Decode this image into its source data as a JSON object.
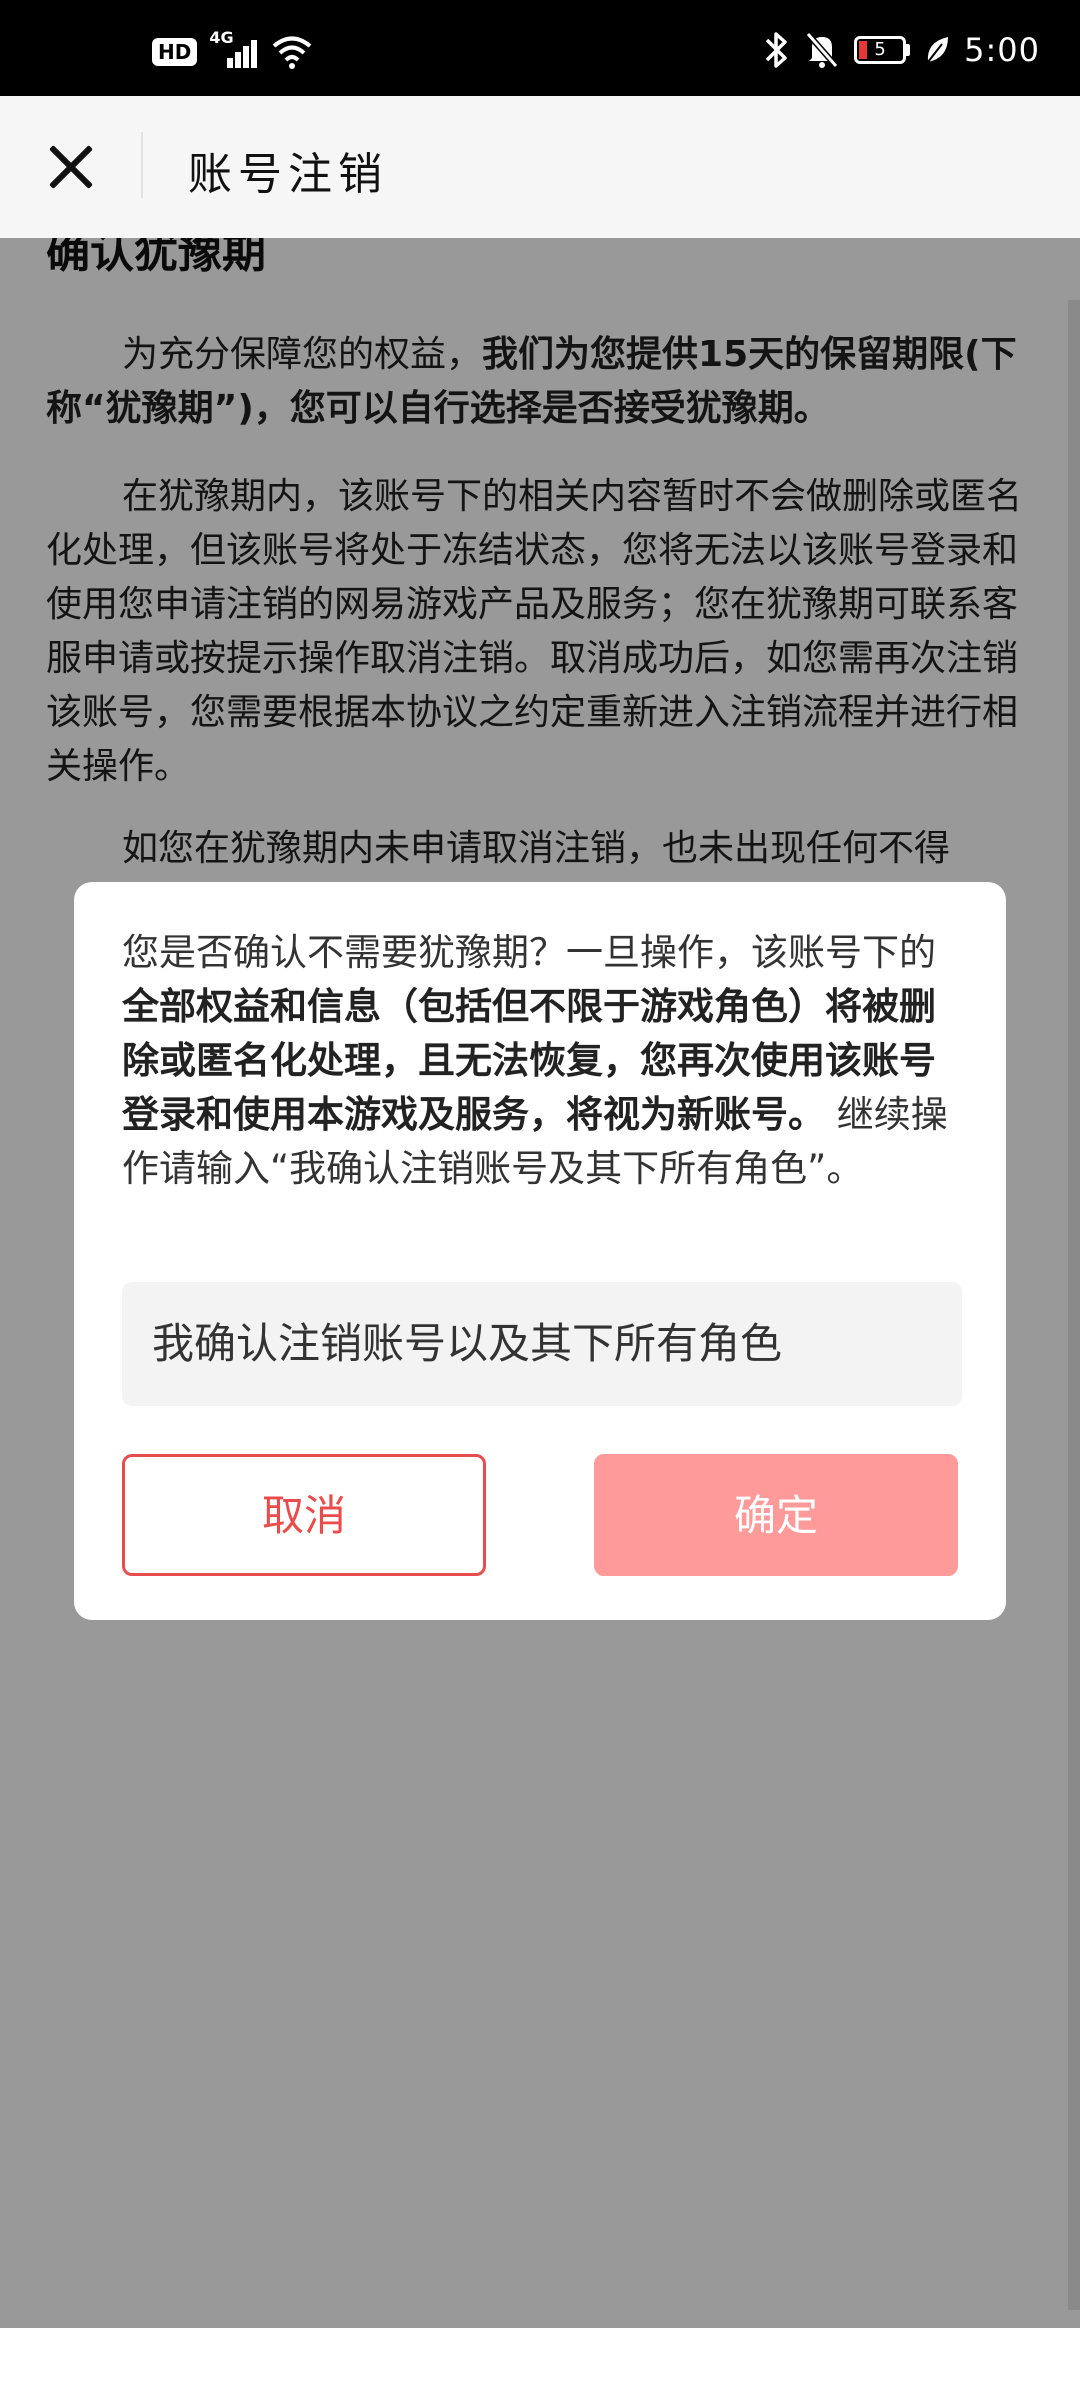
{
  "status_bar": {
    "hd_label": "HD",
    "network_label": "4G",
    "battery_level": "5",
    "time": "5:00"
  },
  "header": {
    "title": "账号注销"
  },
  "content": {
    "section_title": "确认犹豫期",
    "para1_prefix": "为充分保障您的权益，",
    "para1_bold": "我们为您提供15天的保留期限(下称“犹豫期”)，您可以自行选择是否接受犹豫期。",
    "para2": "在犹豫期内，该账号下的相关内容暂时不会做删除或匿名化处理，但该账号将处于冻结状态，您将无法以该账号登录和使用您申请注销的网易游戏产品及服务；您在犹豫期可联系客服申请或按提示操作取消注销。取消成功后，如您需再次注销该账号，您需要根据本协议之约定重新进入注销流程并进行相关操作。",
    "para3_visible": "如您在犹豫期内未申请取消注销，也未出现任何不得"
  },
  "dialog": {
    "text_prefix": "您是否确认不需要犹豫期？一旦操作，该账号下的",
    "text_bold": "全部权益和信息（包括但不限于游戏角色）将被删除或匿名化处理，且无法恢复，您再次使用该账号登录和使用本游戏及服务，将视为新账号。",
    "text_suffix": " 继续操作请输入“我确认注销账号及其下所有角色”。",
    "input_value": "我确认注销账号以及其下所有角色",
    "cancel_label": "取消",
    "confirm_label": "确定"
  },
  "colors": {
    "accent_red": "#e84c4c",
    "confirm_disabled": "#ff9a9a"
  }
}
